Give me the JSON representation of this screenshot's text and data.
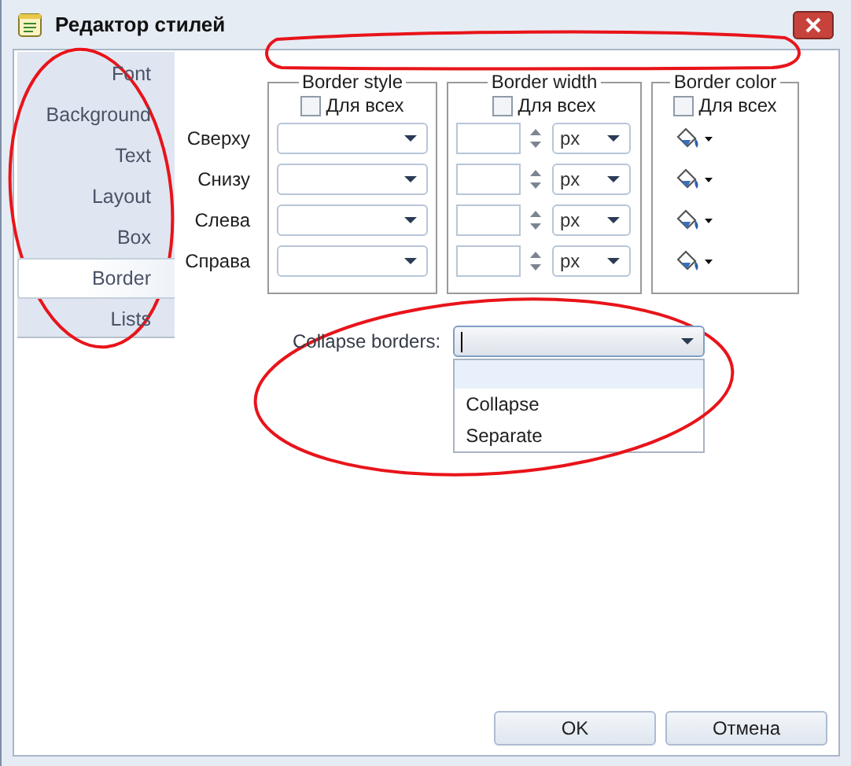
{
  "window": {
    "title": "Редактор стилей"
  },
  "nav": [
    {
      "label": "Font",
      "selected": false
    },
    {
      "label": "Background",
      "selected": false
    },
    {
      "label": "Text",
      "selected": false
    },
    {
      "label": "Layout",
      "selected": false
    },
    {
      "label": "Box",
      "selected": false
    },
    {
      "label": "Border",
      "selected": true
    },
    {
      "label": "Lists",
      "selected": false
    }
  ],
  "sides": [
    {
      "label": "Сверху",
      "unit": "px"
    },
    {
      "label": "Снизу",
      "unit": "px"
    },
    {
      "label": "Слева",
      "unit": "px"
    },
    {
      "label": "Справа",
      "unit": "px"
    }
  ],
  "groups": [
    {
      "kind": "style",
      "title": "Border style",
      "all_label": "Для всех",
      "all_checked": false
    },
    {
      "kind": "width",
      "title": "Border width",
      "all_label": "Для всех",
      "all_checked": false
    },
    {
      "kind": "color",
      "title": "Border color",
      "all_label": "Для всех",
      "all_checked": false
    }
  ],
  "collapse": {
    "label": "Collapse borders:",
    "expanded": true,
    "blank_option_highlighted": true,
    "options": [
      {
        "label": "Collapse",
        "selected": false
      },
      {
        "label": "Separate",
        "selected": false
      }
    ]
  },
  "buttons": [
    {
      "label": "OK"
    },
    {
      "label": "Отмена"
    }
  ]
}
